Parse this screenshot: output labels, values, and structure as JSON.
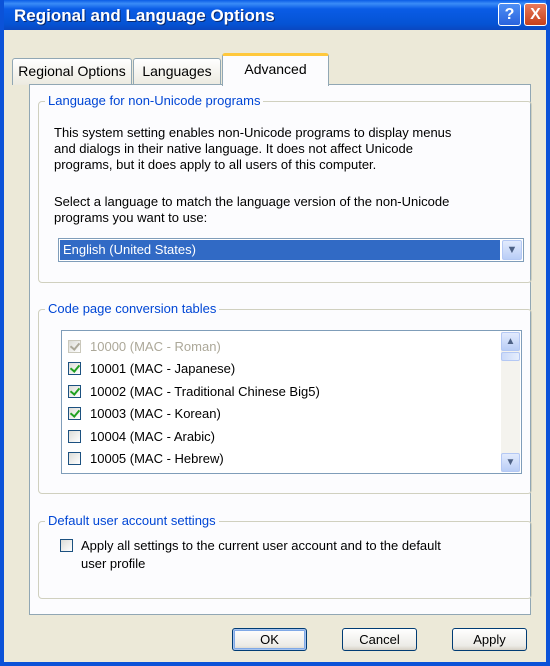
{
  "window": {
    "title": "Regional and Language Options",
    "help_glyph": "?",
    "close_glyph": "X"
  },
  "tabs": [
    {
      "label": "Regional Options"
    },
    {
      "label": "Languages"
    },
    {
      "label": "Advanced",
      "active": true
    }
  ],
  "non_unicode": {
    "legend": "Language for non-Unicode programs",
    "desc_lines": [
      "This system setting enables non-Unicode programs to display menus",
      "and dialogs in their native language. It does not affect Unicode",
      "programs, but it does apply to all users of this computer."
    ],
    "select_lines": [
      "Select a language to match the language version of the non-Unicode",
      "programs you want to use:"
    ],
    "selected_language": "English (United States)"
  },
  "code_page": {
    "legend": "Code page conversion tables",
    "items": [
      {
        "label": "10000 (MAC - Roman)",
        "checked": true,
        "disabled": true
      },
      {
        "label": "10001 (MAC - Japanese)",
        "checked": true,
        "disabled": false
      },
      {
        "label": "10002 (MAC - Traditional Chinese Big5)",
        "checked": true,
        "disabled": false
      },
      {
        "label": "10003 (MAC - Korean)",
        "checked": true,
        "disabled": false
      },
      {
        "label": "10004 (MAC - Arabic)",
        "checked": false,
        "disabled": false
      },
      {
        "label": "10005 (MAC - Hebrew)",
        "checked": false,
        "disabled": false
      }
    ]
  },
  "default_user": {
    "legend": "Default user account settings",
    "checkbox_lines": [
      "Apply all settings to the current user account and to the default",
      "user profile"
    ],
    "checked": false
  },
  "buttons": {
    "ok": "OK",
    "cancel": "Cancel",
    "apply": "Apply"
  },
  "colors": {
    "title_bar": "#0a5ce6",
    "legend_text": "#0046d5",
    "selection": "#316ac5",
    "active_tab_accent": "#ffc83c"
  },
  "icons": {
    "combo_arrow": "chevron-down-icon",
    "scroll_up": "chevron-up-icon",
    "scroll_down": "chevron-down-icon"
  }
}
